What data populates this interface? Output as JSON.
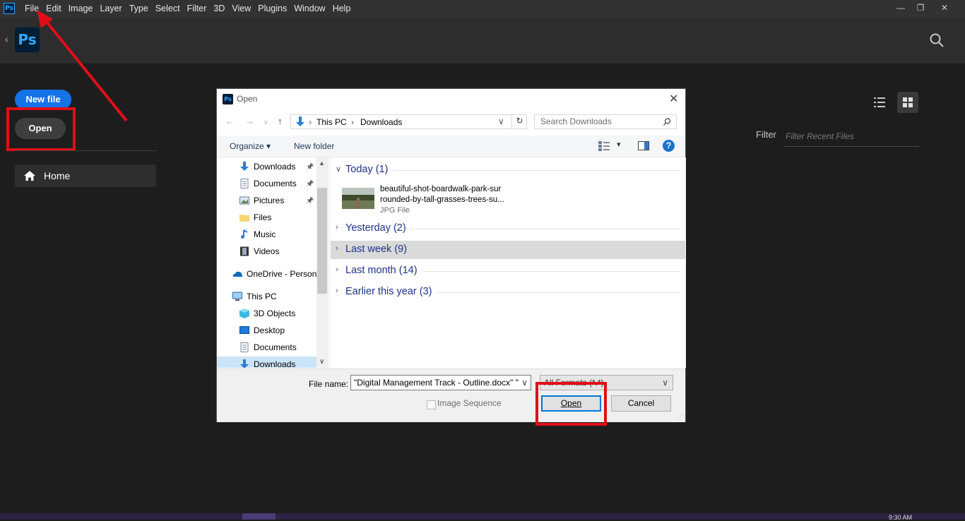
{
  "app": {
    "logo_small": "Ps",
    "logo_big": "Ps",
    "menu": [
      "File",
      "Edit",
      "Image",
      "Layer",
      "Type",
      "Select",
      "Filter",
      "3D",
      "View",
      "Plugins",
      "Window",
      "Help"
    ],
    "window_controls": {
      "minimize": "—",
      "restore": "❐",
      "close": "✕"
    }
  },
  "home": {
    "new_file": "New file",
    "open": "Open",
    "nav_home": "Home",
    "filter_label": "Filter",
    "filter_placeholder": "Filter Recent Files",
    "view_buttons": [
      "list-view-icon",
      "grid-view-icon"
    ]
  },
  "dialog": {
    "title": "Open",
    "address": {
      "root": "This PC",
      "folder": "Downloads"
    },
    "search_placeholder": "Search Downloads",
    "toolbar": {
      "organize": "Organize",
      "new_folder": "New folder",
      "help": "?"
    },
    "nav_items": [
      {
        "label": "Downloads",
        "icon": "download-icon",
        "pinned": true
      },
      {
        "label": "Documents",
        "icon": "document-icon",
        "pinned": true
      },
      {
        "label": "Pictures",
        "icon": "pictures-icon",
        "pinned": true
      },
      {
        "label": "Files",
        "icon": "folder-icon",
        "pinned": false
      },
      {
        "label": "Music",
        "icon": "music-icon",
        "pinned": false
      },
      {
        "label": "Videos",
        "icon": "video-icon",
        "pinned": false
      },
      {
        "label": "OneDrive - Person",
        "icon": "onedrive-icon",
        "pinned": false
      },
      {
        "label": "This PC",
        "icon": "computer-icon",
        "pinned": false
      },
      {
        "label": "3D Objects",
        "icon": "cube-icon",
        "pinned": false
      },
      {
        "label": "Desktop",
        "icon": "desktop-icon",
        "pinned": false
      },
      {
        "label": "Documents",
        "icon": "document-icon",
        "pinned": false
      },
      {
        "label": "Downloads",
        "icon": "download-icon",
        "pinned": false,
        "selected": true
      }
    ],
    "groups": [
      {
        "label": "Today (1)",
        "expanded": true
      },
      {
        "label": "Yesterday (2)",
        "expanded": false
      },
      {
        "label": "Last week (9)",
        "expanded": false,
        "highlighted": true
      },
      {
        "label": "Last month (14)",
        "expanded": false
      },
      {
        "label": "Earlier this year (3)",
        "expanded": false
      }
    ],
    "file": {
      "name_line1": "beautiful-shot-boardwalk-park-sur",
      "name_line2": "rounded-by-tall-grasses-trees-su...",
      "type": "JPG File"
    },
    "file_name_label": "File name:",
    "file_name_value": "\"Digital Management Track - Outline.docx\" \"",
    "file_type_value": "All Formats (*.*)",
    "image_sequence": "Image Sequence",
    "open_button": "Open",
    "cancel_button": "Cancel"
  },
  "taskbar": {
    "time": "9:30 AM"
  },
  "colors": {
    "accent_blue": "#1473e6",
    "annotation_red": "#e10e18",
    "ps_blue": "#31a8ff"
  }
}
